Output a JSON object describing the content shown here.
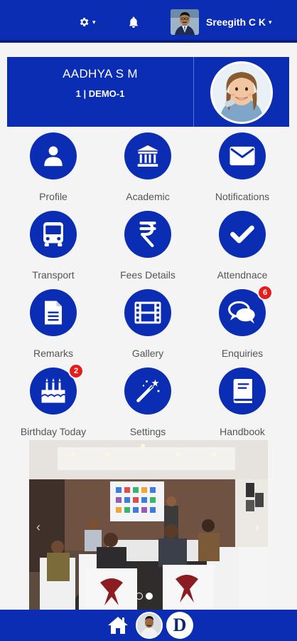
{
  "header": {
    "user_name": "Sreegith C K",
    "icons": [
      "gear-icon",
      "bell-icon",
      "user-avatar"
    ]
  },
  "student": {
    "name": "AADHYA S M",
    "class": "1 | DEMO-1"
  },
  "menu": [
    {
      "label": "Profile",
      "icon": "user-icon"
    },
    {
      "label": "Academic",
      "icon": "institution-icon"
    },
    {
      "label": "Notifications",
      "icon": "envelope-icon"
    },
    {
      "label": "Transport",
      "icon": "bus-icon"
    },
    {
      "label": "Fees Details",
      "icon": "rupee-icon"
    },
    {
      "label": "Attendnace",
      "icon": "check-icon"
    },
    {
      "label": "Remarks",
      "icon": "document-icon"
    },
    {
      "label": "Gallery",
      "icon": "film-icon"
    },
    {
      "label": "Enquiries",
      "icon": "chat-icon",
      "badge": "6"
    },
    {
      "label": "Birthday Today",
      "icon": "birthday-cake-icon",
      "badge": "2"
    },
    {
      "label": "Settings",
      "icon": "magic-wand-icon"
    },
    {
      "label": "Handbook",
      "icon": "book-icon"
    }
  ],
  "carousel": {
    "slide_count": 2,
    "active_index": 1
  },
  "colors": {
    "primary": "#0b2db4",
    "badge": "#e51d1d",
    "background": "#f4f4f4"
  }
}
